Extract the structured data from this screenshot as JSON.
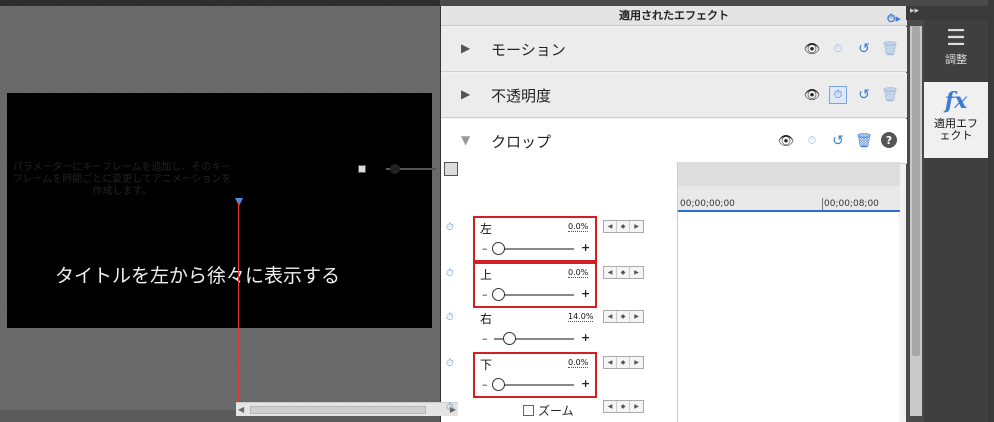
{
  "video": {
    "title_text": "タイトルを左から徐々に表示する"
  },
  "panel": {
    "title": "適用されたエフェクト",
    "effects": [
      {
        "label": "モーション",
        "expanded": false
      },
      {
        "label": "不透明度",
        "expanded": false
      },
      {
        "label": "クロップ",
        "expanded": true
      }
    ],
    "tip": "パラメーターにキーフレームを追加し、そのキーフレームを時間ごとに変更してアニメーションを作成します。",
    "params": [
      {
        "name": "左",
        "value": "0.0%",
        "slider_fraction": 0.0,
        "highlighted": true
      },
      {
        "name": "上",
        "value": "0.0%",
        "slider_fraction": 0.0,
        "highlighted": true
      },
      {
        "name": "右",
        "value": "14.0%",
        "slider_fraction": 0.14,
        "highlighted": false
      },
      {
        "name": "下",
        "value": "0.0%",
        "slider_fraction": 0.0,
        "highlighted": true
      }
    ],
    "zoom_label": "ズーム",
    "timeline": {
      "t_start": "00;00;00;00",
      "t_mid": "00;00;08;00"
    },
    "minus": "–",
    "plus": "+"
  },
  "side": {
    "adjust_label": "調整",
    "applied_label": "適用エフェクト"
  },
  "colors": {
    "accent": "#3a7bd5",
    "highlight_box": "#d21f1f",
    "playhead": "#e23b3b"
  }
}
